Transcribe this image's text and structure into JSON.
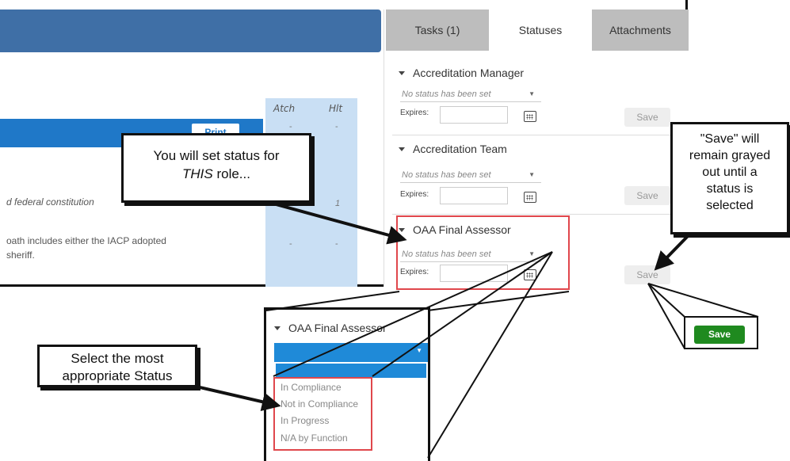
{
  "left_pane": {
    "col_headers": [
      "Atch",
      "Hlt"
    ],
    "print_label": "Print",
    "row1_atch": "-",
    "row1_hlt": "-",
    "row2_text": "d federal constitution",
    "row2_hlt": "1",
    "row3_text_line1": "oath includes either the IACP adopted",
    "row3_text_line2": "sheriff.",
    "row3_atch": "-",
    "row3_hlt": "-"
  },
  "tabs": [
    {
      "label": "Tasks (1)",
      "active": false
    },
    {
      "label": "Statuses",
      "active": true
    },
    {
      "label": "Attachments",
      "active": false
    }
  ],
  "sections": [
    {
      "title": "Accreditation Manager",
      "placeholder": "No status has been set",
      "expires_label": "Expires:",
      "save_label": "Save"
    },
    {
      "title": "Accreditation Team",
      "placeholder": "No status has been set",
      "expires_label": "Expires:",
      "save_label": "Save"
    },
    {
      "title": "OAA Final Assessor",
      "placeholder": "No status has been set",
      "expires_label": "Expires:",
      "save_label": "Save"
    }
  ],
  "callouts": {
    "role": {
      "line1": "You will set status for",
      "line2_em": "THIS",
      "line2_rest": " role..."
    },
    "save_note": [
      "\"Save\" will",
      "remain grayed",
      "out until a",
      "status is",
      "selected"
    ],
    "select": [
      "Select the most",
      "appropriate Status"
    ]
  },
  "zoom": {
    "title": "OAA Final Assessor",
    "options": [
      "In Compliance",
      "Not in Compliance",
      "In Progress",
      "N/A by Function"
    ]
  },
  "enabled_save_label": "Save",
  "colors": {
    "header_blue": "#3f6fa6",
    "select_blue": "#1f8ad8",
    "highlight_red": "#e0474c",
    "save_green": "#1f8a1f",
    "tab_gray": "#bdbdbd"
  }
}
